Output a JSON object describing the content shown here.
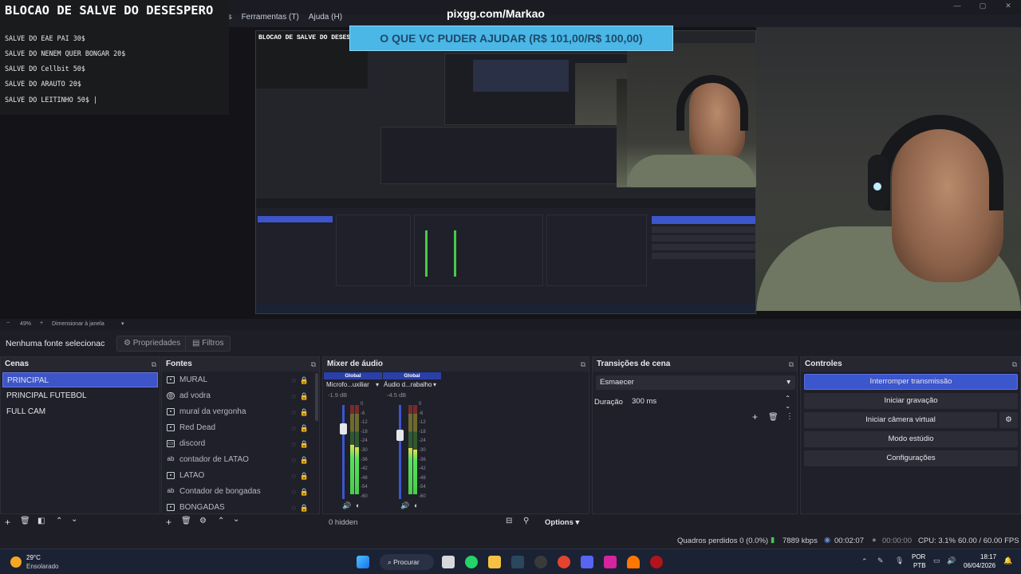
{
  "app": {
    "menus": [
      "as",
      "Ferramentas (T)",
      "Ajuda (H)"
    ]
  },
  "overlay": {
    "blocao_title": "BLOCAO DE SALVE DO DESESPERO",
    "salves": [
      "SALVE DO EAE PAI 30$",
      "SALVE DO NENEM QUER BONGAR 20$",
      "SALVE DO Cellbit 50$",
      "SALVE DO ARAUTO 20$",
      "SALVE DO LEITINHO 50$ |"
    ],
    "pix_url": "pixgg.com/Markao",
    "banner": "O QUE VC PUDER AJUDAR (R$ 101,00/R$ 100,00)"
  },
  "zoom": {
    "percent": "49%",
    "mode": "Dimensionar à janela"
  },
  "toolbar": {
    "no_source": "Nenhuma fonte selecionac",
    "properties": "Propriedades",
    "filters": "Filtros"
  },
  "scenes": {
    "title": "Cenas",
    "items": [
      "PRINCIPAL",
      "PRINCIPAL FUTEBOL",
      "FULL CAM"
    ],
    "selected": 0
  },
  "sources": {
    "title": "Fontes",
    "items": [
      {
        "label": "MURAL",
        "icon": "image-icon"
      },
      {
        "label": "ad vodra",
        "icon": "browser-icon"
      },
      {
        "label": "mural da vergonha",
        "icon": "image-icon"
      },
      {
        "label": "Red Dead",
        "icon": "image-icon"
      },
      {
        "label": "discord",
        "icon": "window-icon"
      },
      {
        "label": "contador de LATAO",
        "icon": "text-icon"
      },
      {
        "label": "LATAO",
        "icon": "image-icon"
      },
      {
        "label": "Contador de bongadas",
        "icon": "text-icon"
      },
      {
        "label": "BONGADAS",
        "icon": "image-icon"
      }
    ]
  },
  "mixer": {
    "title": "Mixer de áudio",
    "channels": [
      {
        "scope": "Global",
        "name": "Microfo...uxiliar",
        "db": "-1.9 dB",
        "level": 0.55,
        "fader": 0.78
      },
      {
        "scope": "Global",
        "name": "Áudio d...rabalho",
        "db": "-4.5 dB",
        "level": 0.52,
        "fader": 0.7
      }
    ],
    "ticks": [
      "0",
      "-6",
      "-12",
      "-18",
      "-24",
      "-30",
      "-36",
      "-42",
      "-48",
      "-54",
      "-60"
    ],
    "hidden": "0 hidden",
    "options": "Options"
  },
  "transitions": {
    "title": "Transições de cena",
    "selected": "Esmaecer",
    "duration_label": "Duração",
    "duration": "300 ms"
  },
  "controls": {
    "title": "Controles",
    "buttons": [
      "Interromper transmissão",
      "Iniciar gravação",
      "Iniciar câmera virtual",
      "Modo estúdio",
      "Configurações"
    ]
  },
  "status": {
    "dropped": "Quadros perdidos 0 (0.0%)",
    "bitrate": "7889 kbps",
    "stream_time": "00:02:07",
    "rec_time": "00:00:00",
    "cpu": "CPU: 3.1%",
    "fps": "60.00 / 60.00 FPS"
  },
  "taskbar": {
    "temp": "29°C",
    "weather": "Ensolarado",
    "search": "Procurar",
    "lang": "POR",
    "lang2": "PTB",
    "time": "18:17",
    "date": "06/04/2026"
  },
  "colors": {
    "accent": "#3c56cc",
    "banner": "#4ab7e6"
  }
}
